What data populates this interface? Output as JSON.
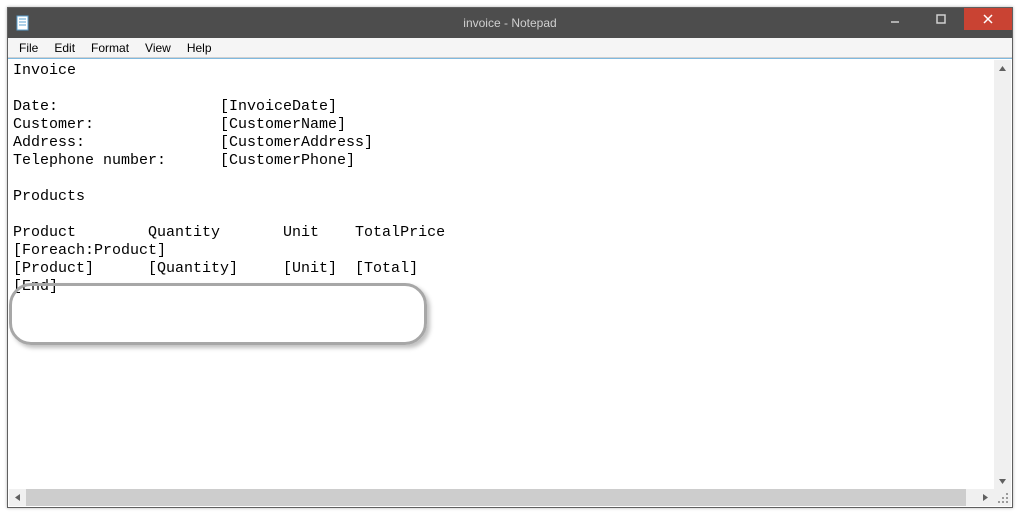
{
  "window": {
    "title": "invoice - Notepad"
  },
  "menu": {
    "file": "File",
    "edit": "Edit",
    "format": "Format",
    "view": "View",
    "help": "Help"
  },
  "content": {
    "line1": "Invoice",
    "line2": "",
    "line3": "Date:                  [InvoiceDate]",
    "line4": "Customer:              [CustomerName]",
    "line5": "Address:               [CustomerAddress]",
    "line6": "Telephone number:      [CustomerPhone]",
    "line7": "",
    "line8": "Products",
    "line9": "",
    "line10": "Product        Quantity       Unit    TotalPrice",
    "line11": "[Foreach:Product]",
    "line12": "[Product]      [Quantity]     [Unit]  [Total]",
    "line13": "[End]"
  }
}
